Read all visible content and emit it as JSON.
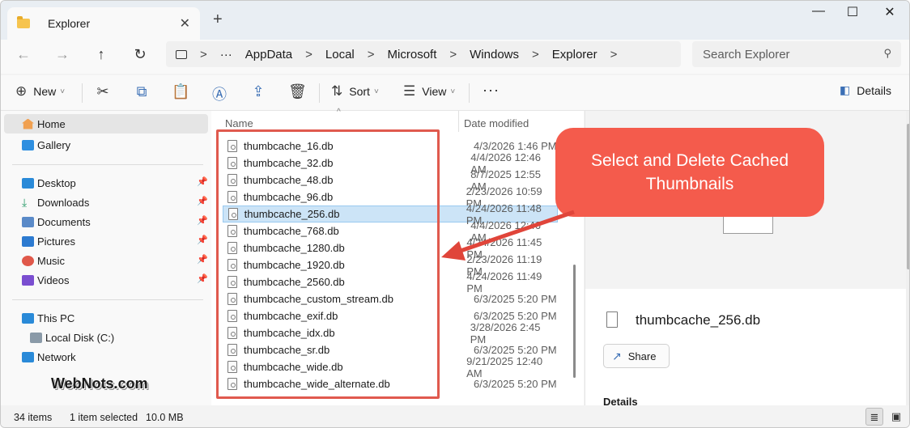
{
  "window": {
    "tab_title": "Explorer",
    "new_tab": "+",
    "minimize": "—",
    "maximize": "☐",
    "close": "✕",
    "tab_close": "✕"
  },
  "address": {
    "back": "←",
    "forward": "→",
    "up": "↑",
    "refresh": "↻",
    "more": "···",
    "crumbs": [
      "AppData",
      "Local",
      "Microsoft",
      "Windows",
      "Explorer"
    ],
    "sep": ">",
    "search_placeholder": "Search Explorer",
    "search_icon": "⚲"
  },
  "toolbar": {
    "new_label": "New",
    "sort_label": "Sort",
    "view_label": "View",
    "more_label": "···",
    "details_label": "Details",
    "caret": "˅",
    "icons": [
      "cut-icon",
      "copy-icon",
      "paste-icon",
      "rename-icon",
      "share-icon",
      "delete-icon"
    ]
  },
  "nav": {
    "home": "Home",
    "gallery": "Gallery",
    "desktop": "Desktop",
    "downloads": "Downloads",
    "documents": "Documents",
    "pictures": "Pictures",
    "music": "Music",
    "videos": "Videos",
    "thispc": "This PC",
    "localdisk": "Local Disk (C:)",
    "network": "Network",
    "pin": "📌"
  },
  "watermark": "WebNots.com",
  "list": {
    "col_name": "Name",
    "col_date": "Date modified",
    "sort_caret": "^",
    "files": [
      {
        "name": "thumbcache_16.db",
        "date": "4/3/2026 1:46 PM"
      },
      {
        "name": "thumbcache_32.db",
        "date": "4/4/2026 12:46 AM"
      },
      {
        "name": "thumbcache_48.db",
        "date": "8/7/2025 12:55 AM"
      },
      {
        "name": "thumbcache_96.db",
        "date": "2/23/2026 10:59 PM"
      },
      {
        "name": "thumbcache_256.db",
        "date": "4/24/2026 11:48 PM",
        "selected": true
      },
      {
        "name": "thumbcache_768.db",
        "date": "4/4/2026 12:46 AM"
      },
      {
        "name": "thumbcache_1280.db",
        "date": "4/24/2026 11:45 PM"
      },
      {
        "name": "thumbcache_1920.db",
        "date": "2/23/2026 11:19 PM"
      },
      {
        "name": "thumbcache_2560.db",
        "date": "4/24/2026 11:49 PM"
      },
      {
        "name": "thumbcache_custom_stream.db",
        "date": "6/3/2025 5:20 PM"
      },
      {
        "name": "thumbcache_exif.db",
        "date": "6/3/2025 5:20 PM"
      },
      {
        "name": "thumbcache_idx.db",
        "date": "3/28/2026 2:45 PM"
      },
      {
        "name": "thumbcache_sr.db",
        "date": "6/3/2025 5:20 PM"
      },
      {
        "name": "thumbcache_wide.db",
        "date": "9/21/2025 12:40 AM"
      },
      {
        "name": "thumbcache_wide_alternate.db",
        "date": "6/3/2025 5:20 PM"
      }
    ]
  },
  "details": {
    "file_name": "thumbcache_256.db",
    "share_label": "Share",
    "share_icon": "↗",
    "section_label": "Details"
  },
  "callout": {
    "line1": "Select and Delete Cached",
    "line2": "Thumbnails",
    "color": "#f45b4c"
  },
  "status": {
    "items": "34 items",
    "selected": "1 item selected",
    "size": "10.0 MB"
  }
}
